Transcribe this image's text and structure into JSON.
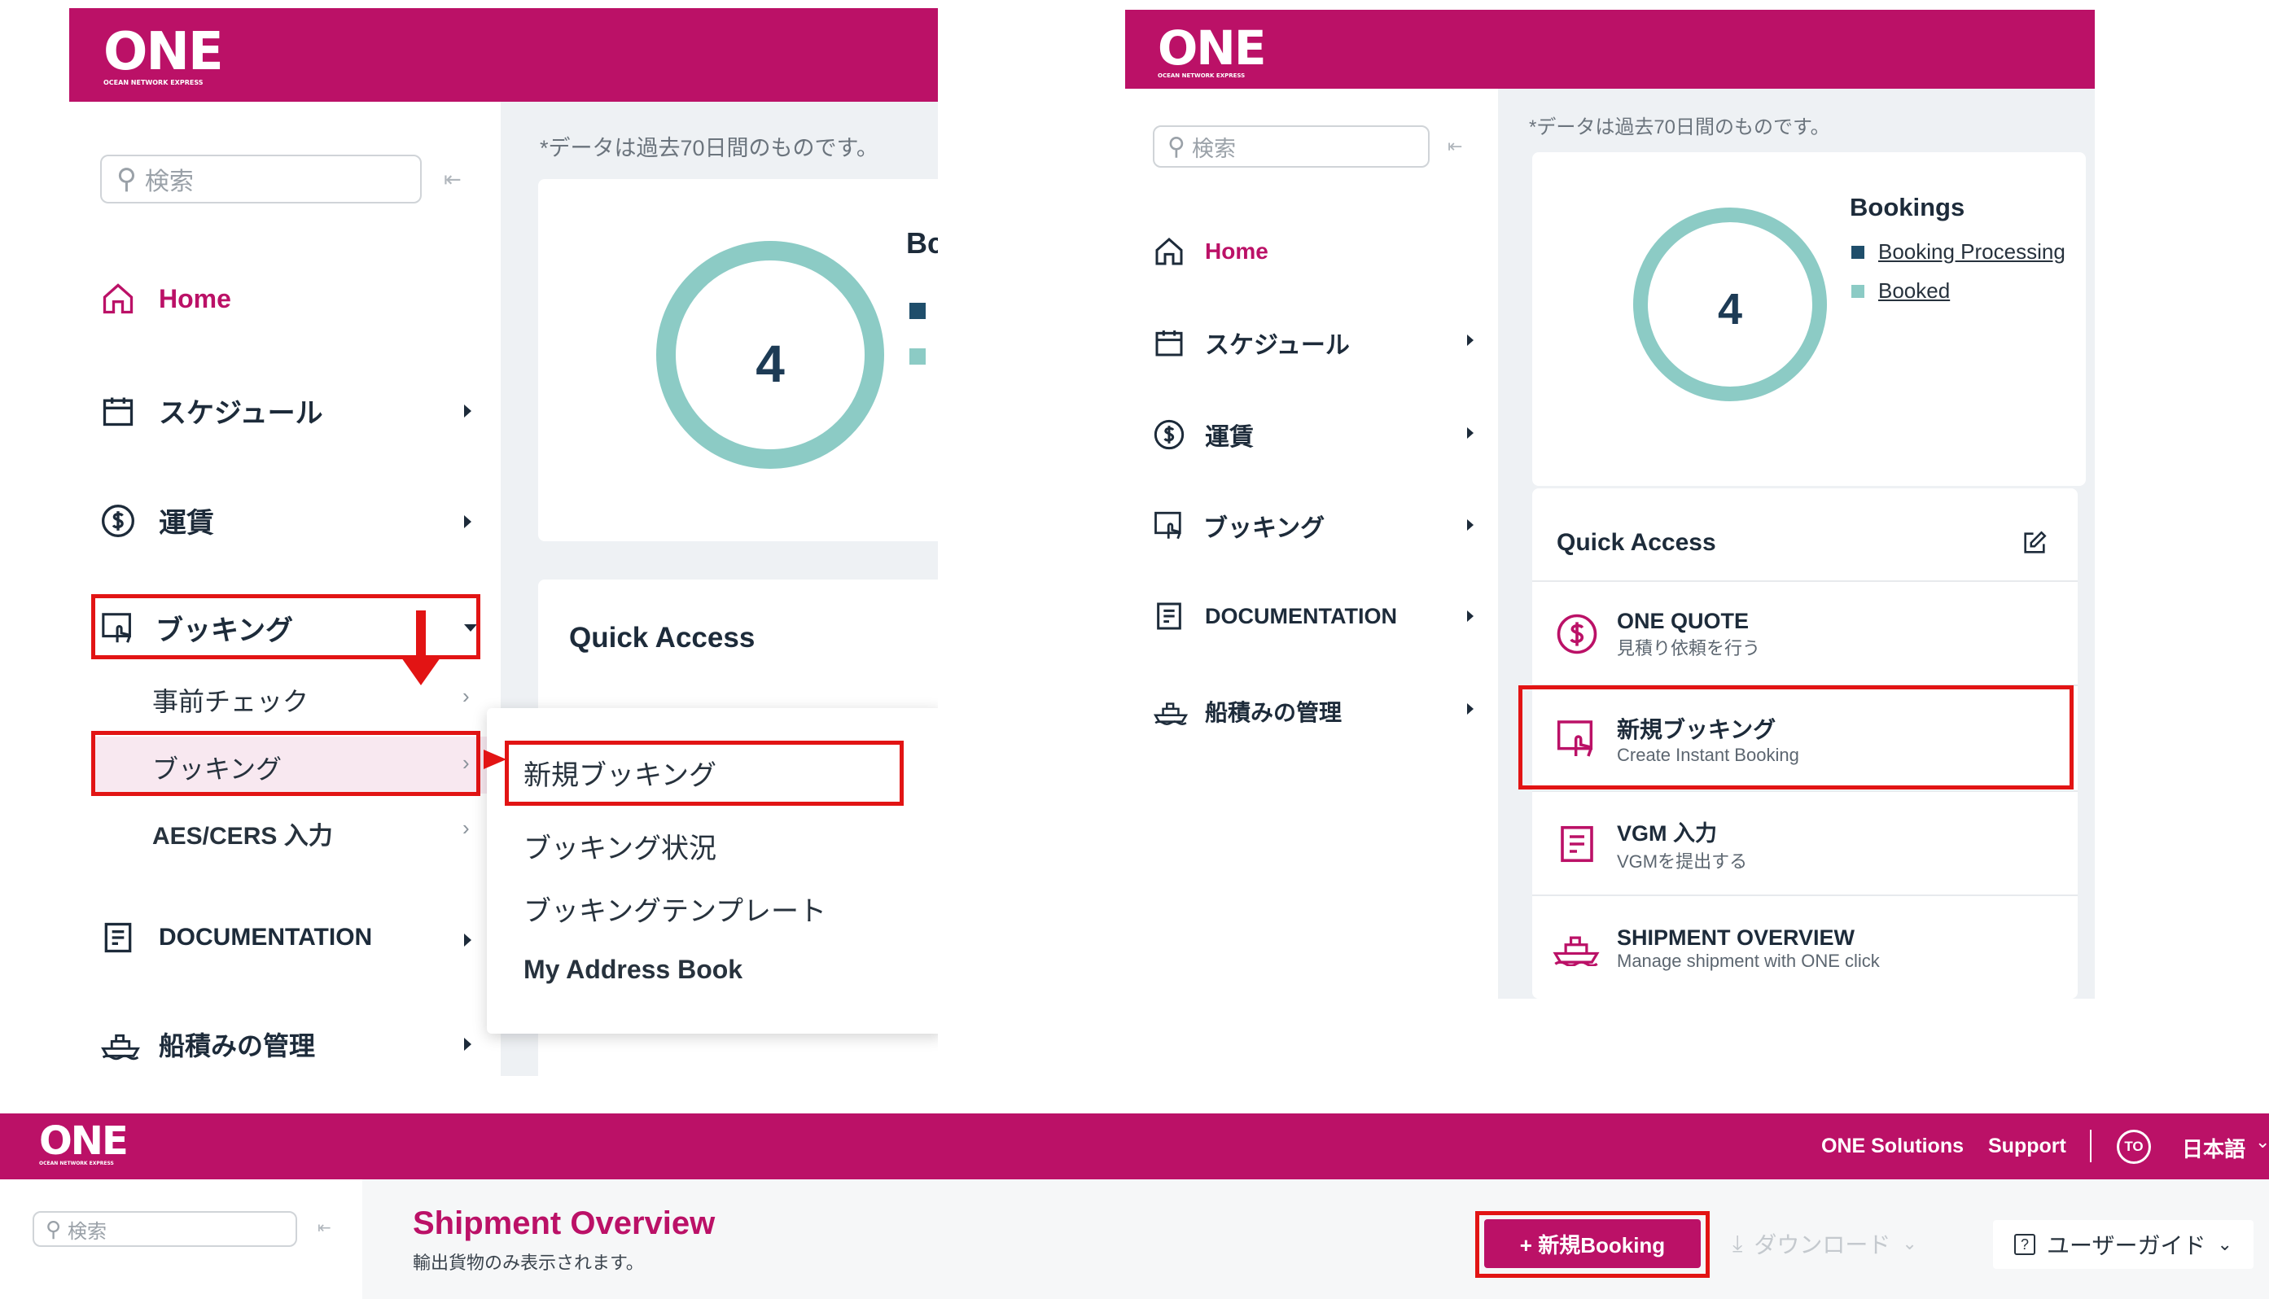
{
  "logo": {
    "main": "ONE",
    "tagline": "OCEAN NETWORK EXPRESS"
  },
  "search": {
    "placeholder": "検索"
  },
  "data_note": "*データは過去70日間のものです。",
  "nav": {
    "home": "Home",
    "schedule": "スケジュール",
    "rates": "運賃",
    "booking": "ブッキング",
    "documentation": "DOCUMENTATION",
    "shipping_mgmt": "船積みの管理"
  },
  "booking_submenu": {
    "precheck": "事前チェック",
    "booking": "ブッキング",
    "aes": "AES/CERS 入力"
  },
  "booking_flyout": {
    "new_booking": "新規ブッキング",
    "status": "ブッキング状況",
    "template": "ブッキングテンプレート",
    "address_book": "My Address Book"
  },
  "bookings_widget": {
    "title_partial": "Bc",
    "title": "Bookings",
    "count": "4",
    "legend": [
      "Booking Processing",
      "Booked"
    ],
    "colors": {
      "processing": "#1f4e6b",
      "booked": "#8ccbc5"
    }
  },
  "quick_access": {
    "title": "Quick Access",
    "items": [
      {
        "title": "ONE QUOTE",
        "sub": "見積り依頼を行う"
      },
      {
        "title": "新規ブッキング",
        "sub": "Create Instant Booking"
      },
      {
        "title": "VGM 入力",
        "sub": "VGMを提出する"
      },
      {
        "title": "SHIPMENT OVERVIEW",
        "sub": "Manage shipment with ONE click"
      }
    ]
  },
  "header": {
    "solutions": "ONE Solutions",
    "support": "Support",
    "avatar": "TO",
    "language": "日本語"
  },
  "shipment_overview": {
    "title": "Shipment Overview",
    "subtitle": "輸出貨物のみ表示されます。",
    "new_booking": "+ 新規Booking",
    "download": "ダウンロード",
    "guide": "ユーザーガイド"
  },
  "colors": {
    "brand": "#bb1167",
    "highlight": "#e21414",
    "teal": "#8ccbc5"
  }
}
